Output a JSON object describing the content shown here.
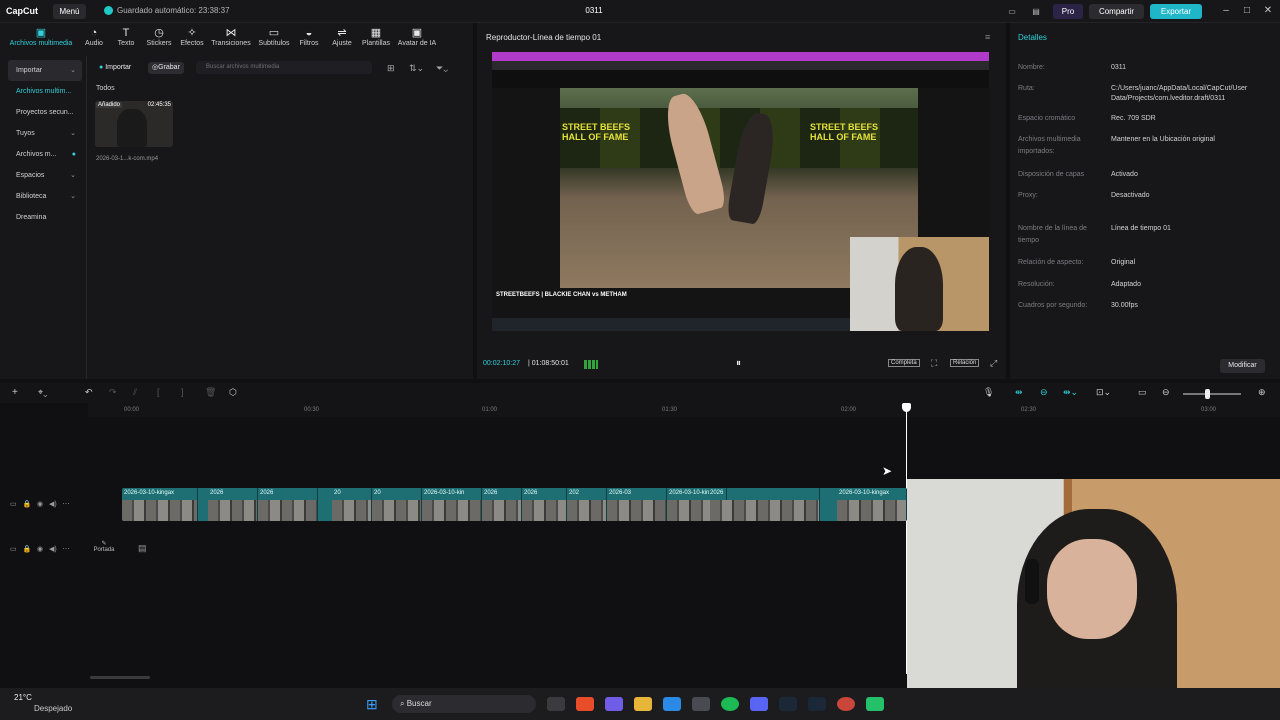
{
  "app": {
    "logo": "CapCut",
    "menu": "Menú",
    "autosave": "Guardado automático: 23:38:37",
    "project_title": "0311"
  },
  "topright": {
    "pro": "Pro",
    "share": "Compartir",
    "export": "Exportar"
  },
  "tools": [
    {
      "label": "Archivos multimedia",
      "icon": "media-icon"
    },
    {
      "label": "Audio",
      "icon": "audio-icon"
    },
    {
      "label": "Texto",
      "icon": "text-icon"
    },
    {
      "label": "Stickers",
      "icon": "sticker-icon"
    },
    {
      "label": "Efectos",
      "icon": "effects-icon"
    },
    {
      "label": "Transiciones",
      "icon": "transition-icon"
    },
    {
      "label": "Subtítulos",
      "icon": "subtitle-icon"
    },
    {
      "label": "Filtros",
      "icon": "filter-icon"
    },
    {
      "label": "Ajuste",
      "icon": "adjust-icon"
    },
    {
      "label": "Plantillas",
      "icon": "template-icon"
    },
    {
      "label": "Avatar de IA",
      "icon": "avatar-icon"
    }
  ],
  "sidenav": [
    {
      "label": "Importar"
    },
    {
      "label": "Archivos multim..."
    },
    {
      "label": "Proyectos secun..."
    },
    {
      "label": "Tuyos"
    },
    {
      "label": "Archivos m..."
    },
    {
      "label": "Espacios"
    },
    {
      "label": "Biblioteca"
    },
    {
      "label": "Dreamina"
    }
  ],
  "media": {
    "import": "Importar",
    "record": "Grabar",
    "search_placeholder": "Buscar archivos multimedia",
    "section": "Todos",
    "item": {
      "badge": "Añadido",
      "duration": "02:45:35",
      "name": "2026-03-1...k-com.mp4"
    }
  },
  "player": {
    "title": "Reproductor-Línea de tiempo 01",
    "current": "00:02:10:27",
    "total": "01:08:50:01",
    "full": "Completa",
    "ratio": "Relación",
    "video_caption": "STREETBEEFS | BLACKIE CHAN vs METHAM",
    "video_sign": "STREET BEEFS HALL OF FAME"
  },
  "details": {
    "header": "Detalles",
    "rows": [
      {
        "label": "Nombre:",
        "value": "0311"
      },
      {
        "label": "Ruta:",
        "value": "C:/Users/juanc/AppData/Local/CapCut/User Data/Projects/com.lveditor.draft/0311"
      },
      {
        "label": "Espacio cromático",
        "value": "Rec. 709 SDR"
      },
      {
        "label": "Archivos multimedia importados:",
        "value": "Mantener en la Ubicación original"
      },
      {
        "label": "Disposición de capas",
        "value": "Activado"
      },
      {
        "label": "Proxy:",
        "value": "Desactivado"
      },
      {
        "label": "Nombre de la línea de tiempo",
        "value": "Línea de tiempo 01"
      },
      {
        "label": "Relación de aspecto:",
        "value": "Original"
      },
      {
        "label": "Resolución:",
        "value": "Adaptado"
      },
      {
        "label": "Cuadros por segundo:",
        "value": "30.00fps"
      }
    ],
    "modify": "Modificar"
  },
  "timeline": {
    "ticks": [
      "00:00",
      "00:30",
      "01:00",
      "01:30",
      "02:00",
      "02:30",
      "03:00"
    ],
    "clips": [
      "2026-03-10-kingax",
      "2026",
      "2026",
      "20",
      "20",
      "2026-03-10-kin",
      "2026",
      "2026",
      "202",
      "2026-03",
      "2026-03-10-kin",
      "2026",
      "2026-03-10-kingax"
    ],
    "cover": "Portada"
  },
  "taskbar": {
    "temp": "21°C",
    "weather": "Despejado",
    "search": "Buscar"
  }
}
